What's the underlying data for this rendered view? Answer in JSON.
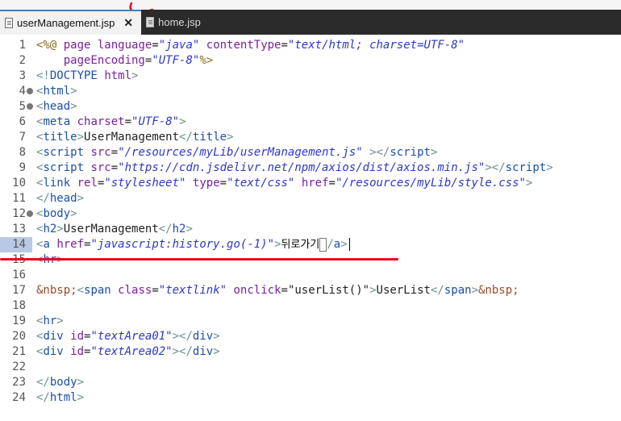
{
  "tabs": [
    {
      "label": "userManagement.jsp",
      "active": true,
      "close": "✕",
      "icon": "jsp-file-icon"
    },
    {
      "label": "home.jsp",
      "active": false,
      "icon": "jsp-file-icon"
    }
  ],
  "editor": {
    "lines": [
      {
        "n": "1",
        "fold": false,
        "tokens": [
          [
            "d",
            "<%@ "
          ],
          [
            "a",
            "page "
          ],
          [
            "a",
            "language"
          ],
          [
            "x",
            "="
          ],
          [
            "s",
            "\"java\""
          ],
          [
            "x",
            " "
          ],
          [
            "a",
            "contentType"
          ],
          [
            "x",
            "="
          ],
          [
            "s",
            "\"text/html; charset=UTF-8\""
          ]
        ]
      },
      {
        "n": "2",
        "fold": false,
        "tokens": [
          [
            "x",
            "    "
          ],
          [
            "a",
            "pageEncoding"
          ],
          [
            "x",
            "="
          ],
          [
            "s",
            "\"UTF-8\""
          ],
          [
            "d",
            "%>"
          ]
        ]
      },
      {
        "n": "3",
        "fold": false,
        "tokens": [
          [
            "b",
            "<!"
          ],
          [
            "t",
            "DOCTYPE"
          ],
          [
            "x",
            " "
          ],
          [
            "a",
            "html"
          ],
          [
            "b",
            ">"
          ]
        ]
      },
      {
        "n": "4",
        "fold": true,
        "tokens": [
          [
            "b",
            "<"
          ],
          [
            "t",
            "html"
          ],
          [
            "b",
            ">"
          ]
        ]
      },
      {
        "n": "5",
        "fold": true,
        "tokens": [
          [
            "b",
            "<"
          ],
          [
            "t",
            "head"
          ],
          [
            "b",
            ">"
          ]
        ]
      },
      {
        "n": "6",
        "fold": false,
        "tokens": [
          [
            "b",
            "<"
          ],
          [
            "t",
            "meta"
          ],
          [
            "x",
            " "
          ],
          [
            "a",
            "charset"
          ],
          [
            "x",
            "="
          ],
          [
            "s",
            "\"UTF-8\""
          ],
          [
            "b",
            ">"
          ]
        ]
      },
      {
        "n": "7",
        "fold": false,
        "tokens": [
          [
            "b",
            "<"
          ],
          [
            "t",
            "title"
          ],
          [
            "b",
            ">"
          ],
          [
            "x",
            "UserManagement"
          ],
          [
            "b",
            "</"
          ],
          [
            "t",
            "title"
          ],
          [
            "b",
            ">"
          ]
        ]
      },
      {
        "n": "8",
        "fold": false,
        "tokens": [
          [
            "b",
            "<"
          ],
          [
            "t",
            "script"
          ],
          [
            "x",
            " "
          ],
          [
            "a",
            "src"
          ],
          [
            "x",
            "="
          ],
          [
            "s",
            "\"/resources/myLib/userManagement.js\""
          ],
          [
            "x",
            " "
          ],
          [
            "b",
            "></"
          ],
          [
            "t",
            "script"
          ],
          [
            "b",
            ">"
          ]
        ]
      },
      {
        "n": "9",
        "fold": false,
        "tokens": [
          [
            "b",
            "<"
          ],
          [
            "t",
            "script"
          ],
          [
            "x",
            " "
          ],
          [
            "a",
            "src"
          ],
          [
            "x",
            "="
          ],
          [
            "s",
            "\"https://cdn.jsdelivr.net/npm/axios/dist/axios.min.js\""
          ],
          [
            "b",
            "></"
          ],
          [
            "t",
            "script"
          ],
          [
            "b",
            ">"
          ]
        ]
      },
      {
        "n": "10",
        "fold": false,
        "tokens": [
          [
            "b",
            "<"
          ],
          [
            "t",
            "link"
          ],
          [
            "x",
            " "
          ],
          [
            "a",
            "rel"
          ],
          [
            "x",
            "="
          ],
          [
            "s",
            "\"stylesheet\""
          ],
          [
            "x",
            " "
          ],
          [
            "a",
            "type"
          ],
          [
            "x",
            "="
          ],
          [
            "s",
            "\"text/css\""
          ],
          [
            "x",
            " "
          ],
          [
            "a",
            "href"
          ],
          [
            "x",
            "="
          ],
          [
            "s",
            "\"/resources/myLib/style.css\""
          ],
          [
            "b",
            ">"
          ]
        ]
      },
      {
        "n": "11",
        "fold": false,
        "tokens": [
          [
            "b",
            "</"
          ],
          [
            "t",
            "head"
          ],
          [
            "b",
            ">"
          ]
        ]
      },
      {
        "n": "12",
        "fold": true,
        "tokens": [
          [
            "b",
            "<"
          ],
          [
            "t",
            "body"
          ],
          [
            "b",
            ">"
          ]
        ]
      },
      {
        "n": "13",
        "fold": false,
        "tokens": [
          [
            "b",
            "<"
          ],
          [
            "t",
            "h2"
          ],
          [
            "b",
            ">"
          ],
          [
            "x",
            "UserManagement"
          ],
          [
            "b",
            "</"
          ],
          [
            "t",
            "h2"
          ],
          [
            "b",
            ">"
          ]
        ]
      },
      {
        "n": "14",
        "fold": false,
        "current": true,
        "tokens": [
          [
            "b",
            "<"
          ],
          [
            "t",
            "a"
          ],
          [
            "x",
            " "
          ],
          [
            "a",
            "href"
          ],
          [
            "x",
            "="
          ],
          [
            "s",
            "\"javascript:history.go(-1)\""
          ],
          [
            "b",
            ">"
          ],
          [
            "kr",
            "뒤로가기"
          ],
          [
            "box",
            ""
          ],
          [
            "b",
            "/"
          ],
          [
            "t",
            "a"
          ],
          [
            "b",
            ">"
          ],
          [
            "caret",
            ""
          ]
        ]
      },
      {
        "n": "15",
        "fold": false,
        "tokens": [
          [
            "b",
            "<"
          ],
          [
            "t",
            "hr"
          ],
          [
            "b",
            ">"
          ]
        ]
      },
      {
        "n": "16",
        "fold": false,
        "tokens": []
      },
      {
        "n": "17",
        "fold": false,
        "tokens": [
          [
            "e",
            "&nbsp;"
          ],
          [
            "b",
            "<"
          ],
          [
            "t",
            "span"
          ],
          [
            "x",
            " "
          ],
          [
            "a",
            "class"
          ],
          [
            "x",
            "="
          ],
          [
            "s",
            "\"textlink\""
          ],
          [
            "x",
            " "
          ],
          [
            "a",
            "onclick"
          ],
          [
            "x",
            "="
          ],
          [
            "x",
            "\"userList()\""
          ],
          [
            "b",
            ">"
          ],
          [
            "x",
            "UserList"
          ],
          [
            "b",
            "</"
          ],
          [
            "t",
            "span"
          ],
          [
            "b",
            ">"
          ],
          [
            "e",
            "&nbsp;"
          ]
        ]
      },
      {
        "n": "18",
        "fold": false,
        "tokens": []
      },
      {
        "n": "19",
        "fold": false,
        "tokens": [
          [
            "b",
            "<"
          ],
          [
            "t",
            "hr"
          ],
          [
            "b",
            ">"
          ]
        ]
      },
      {
        "n": "20",
        "fold": false,
        "tokens": [
          [
            "b",
            "<"
          ],
          [
            "t",
            "div"
          ],
          [
            "x",
            " "
          ],
          [
            "a",
            "id"
          ],
          [
            "x",
            "="
          ],
          [
            "s",
            "\"textArea01\""
          ],
          [
            "b",
            "></"
          ],
          [
            "t",
            "div"
          ],
          [
            "b",
            ">"
          ]
        ]
      },
      {
        "n": "21",
        "fold": false,
        "tokens": [
          [
            "b",
            "<"
          ],
          [
            "t",
            "div"
          ],
          [
            "x",
            " "
          ],
          [
            "a",
            "id"
          ],
          [
            "x",
            "="
          ],
          [
            "s",
            "\"textArea02\""
          ],
          [
            "b",
            "></"
          ],
          [
            "t",
            "div"
          ],
          [
            "b",
            ">"
          ]
        ]
      },
      {
        "n": "22",
        "fold": false,
        "tokens": []
      },
      {
        "n": "23",
        "fold": false,
        "tokens": [
          [
            "b",
            "</"
          ],
          [
            "t",
            "body"
          ],
          [
            "b",
            ">"
          ]
        ]
      },
      {
        "n": "24",
        "fold": false,
        "tokens": [
          [
            "b",
            "</"
          ],
          [
            "t",
            "html"
          ],
          [
            "b",
            ">"
          ]
        ]
      }
    ]
  },
  "annotations": {
    "underline_color": "#e01020"
  }
}
